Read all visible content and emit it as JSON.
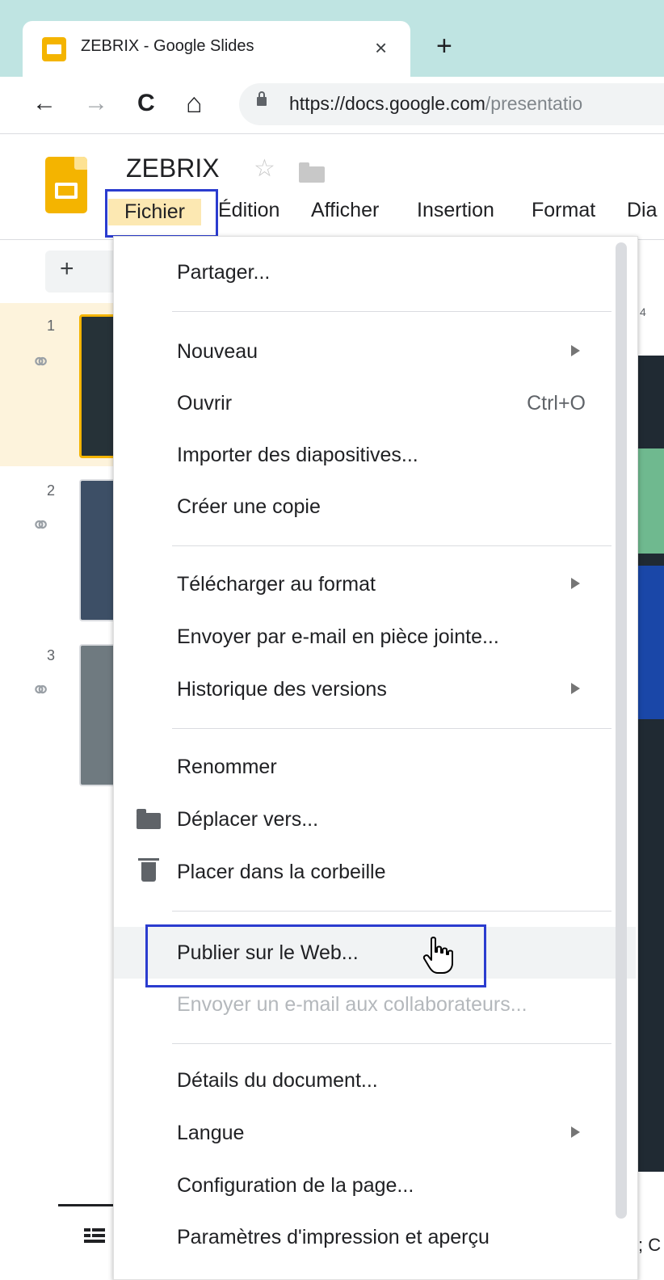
{
  "browser": {
    "tab_title": "ZEBRIX - Google Slides",
    "tab_close": "×",
    "new_tab": "+",
    "back": "←",
    "forward": "→",
    "reload": "C",
    "home": "⌂",
    "url_host": "https://docs.google.com",
    "url_path": "/presentatio"
  },
  "app": {
    "doc_title": "ZEBRIX",
    "star": "☆",
    "menus": [
      "Fichier",
      "Édition",
      "Afficher",
      "Insertion",
      "Format",
      "Dia"
    ],
    "active_menu": "Fichier",
    "accent_color": "#2b3ccf"
  },
  "editor": {
    "toolbar_add": "+",
    "ruler_number": "4",
    "slides": [
      {
        "number": "1",
        "link_icon": "link-icon"
      },
      {
        "number": "2",
        "link_icon": "link-icon"
      },
      {
        "number": "3",
        "link_icon": "link-icon"
      }
    ],
    "bottom_text": "; C"
  },
  "file_menu": {
    "items": [
      {
        "label": "Partager..."
      },
      {
        "label": "Nouveau",
        "submenu": true
      },
      {
        "label": "Ouvrir",
        "shortcut": "Ctrl+O"
      },
      {
        "label": "Importer des diapositives..."
      },
      {
        "label": "Créer une copie"
      },
      {
        "label": "Télécharger au format",
        "submenu": true
      },
      {
        "label": "Envoyer par e-mail en pièce jointe..."
      },
      {
        "label": "Historique des versions",
        "submenu": true
      },
      {
        "label": "Renommer"
      },
      {
        "label": "Déplacer vers...",
        "icon": "folder-icon"
      },
      {
        "label": "Placer dans la corbeille",
        "icon": "trash-icon"
      },
      {
        "label": "Publier sur le Web...",
        "hovered": true
      },
      {
        "label": "Envoyer un e-mail aux collaborateurs...",
        "disabled": true
      },
      {
        "label": "Détails du document..."
      },
      {
        "label": "Langue",
        "submenu": true
      },
      {
        "label": "Configuration de la page..."
      },
      {
        "label": "Paramètres d'impression et aperçu"
      }
    ]
  }
}
